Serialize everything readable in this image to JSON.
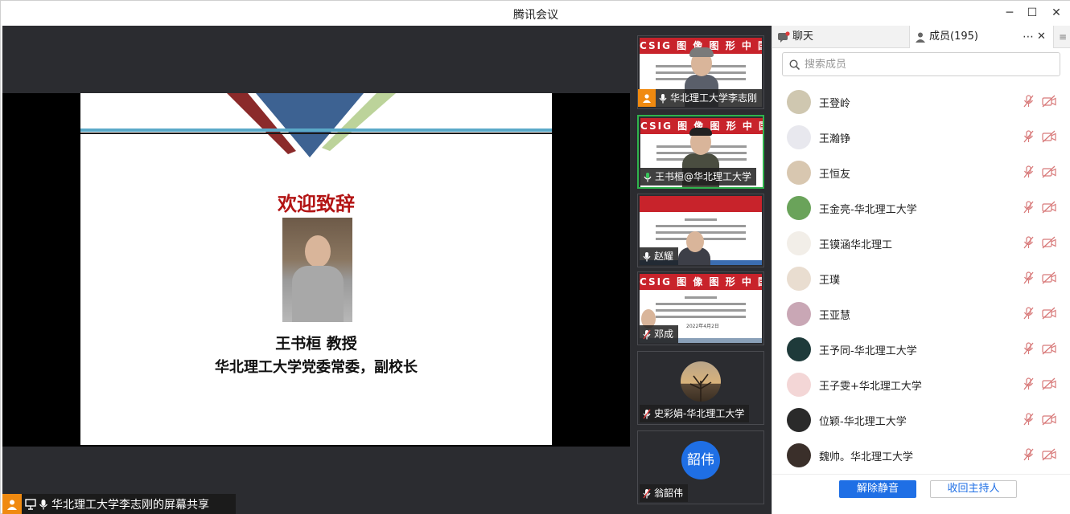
{
  "window": {
    "title": "腾讯会议"
  },
  "slide": {
    "title": "欢迎致辞",
    "speaker_name": "王书桓 教授",
    "speaker_position": "华北理工大学党委常委，副校长"
  },
  "share_bar": {
    "label": "华北理工大学李志刚的屏幕共享"
  },
  "video_tiles": [
    {
      "label": "华北理工大学李志刚",
      "banner": "CSIG 图 像 图 形 中 国 行",
      "active": false
    },
    {
      "label": "王书桓@华北理工大学",
      "banner": "CSIG 图 像 图 形 中 国 行",
      "active": true
    },
    {
      "label": "赵耀",
      "banner": "",
      "active": false
    },
    {
      "label": "邓成",
      "banner": "CSIG 图 像 图 形 中 国 行",
      "date": "2022年4月2日",
      "active": false
    },
    {
      "label": "史彩娟-华北理工大学",
      "active": false
    },
    {
      "label": "翁韶伟",
      "avatar_text": "韶伟",
      "active": false
    }
  ],
  "panel": {
    "tab_chat": "聊天",
    "tab_members": "成员(195)",
    "search_placeholder": "搜索成员",
    "members": [
      "王登岭",
      "王瀚铮",
      "王恒友",
      "王金亮-华北理工大学",
      "王镆涵华北理工",
      "王璞",
      "王亚慧",
      "王予同-华北理工大学",
      "王子雯+华北理工大学",
      "位颖-华北理工大学",
      "魏帅。华北理工大学"
    ],
    "unmute_all": "解除静音",
    "reclaim_host": "收回主持人"
  },
  "colors": {
    "accent": "#1f6fe5",
    "slide_title": "#b31414",
    "banner_red": "#c8232b",
    "active_border": "#2fb34c"
  }
}
